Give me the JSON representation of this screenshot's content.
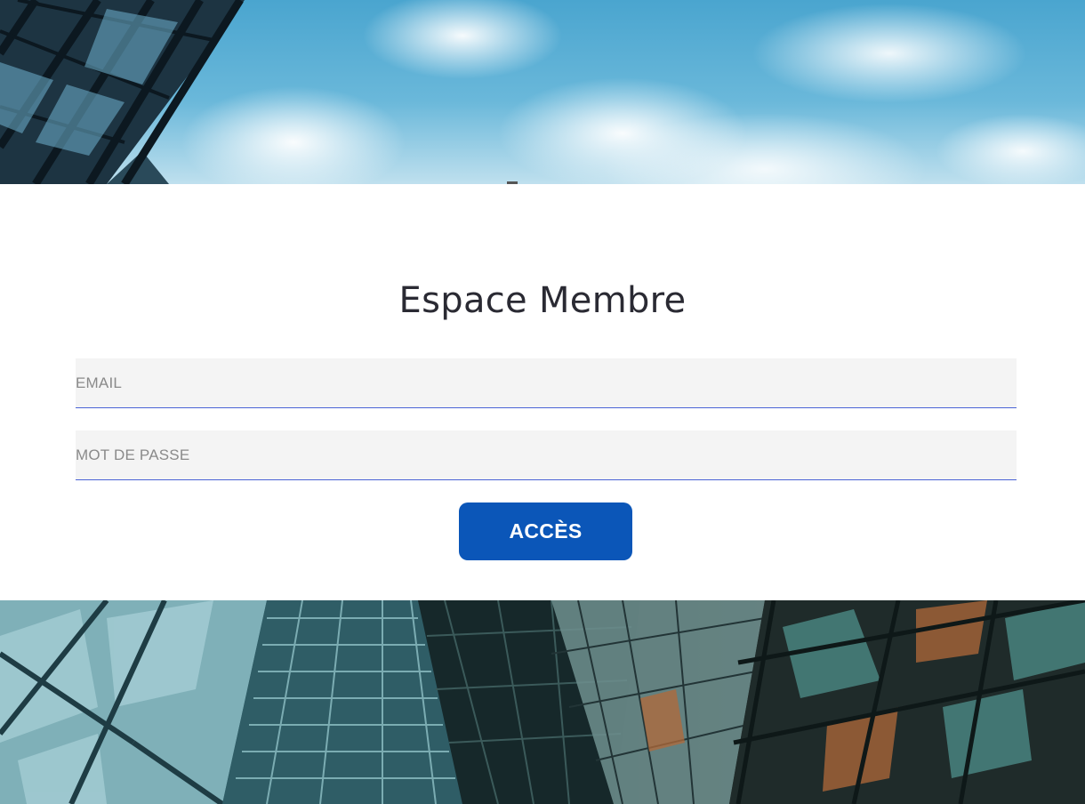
{
  "login": {
    "title": "Espace Membre",
    "email_placeholder": "EMAIL",
    "password_placeholder": "MOT DE PASSE",
    "submit_label": "ACCÈS"
  },
  "colors": {
    "button": "#0b56b8",
    "field_background": "#f4f4f4",
    "field_underline": "#4a63d6",
    "title": "#2a2a33"
  }
}
